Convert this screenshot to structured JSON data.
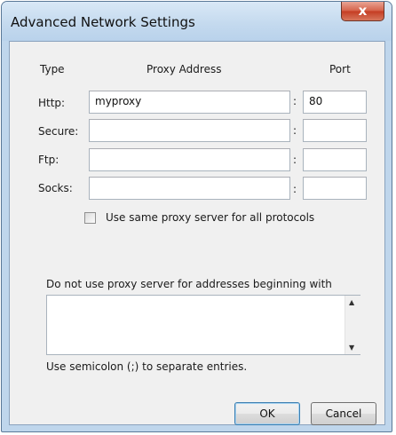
{
  "window": {
    "title": "Advanced Network Settings",
    "close_glyph": "x"
  },
  "columns": {
    "type": "Type",
    "address": "Proxy Address",
    "port": "Port"
  },
  "proxies": [
    {
      "label": "Http:",
      "address": "myproxy",
      "port": "80"
    },
    {
      "label": "Secure:",
      "address": "",
      "port": ""
    },
    {
      "label": "Ftp:",
      "address": "",
      "port": ""
    },
    {
      "label": "Socks:",
      "address": "",
      "port": ""
    }
  ],
  "separator": ":",
  "same_proxy": {
    "label": "Use same proxy server for all protocols",
    "checked": false
  },
  "bypass": {
    "label": "Do not use proxy server for addresses beginning with",
    "value": "",
    "hint": "Use semicolon (;) to separate entries."
  },
  "buttons": {
    "ok": "OK",
    "cancel": "Cancel"
  }
}
